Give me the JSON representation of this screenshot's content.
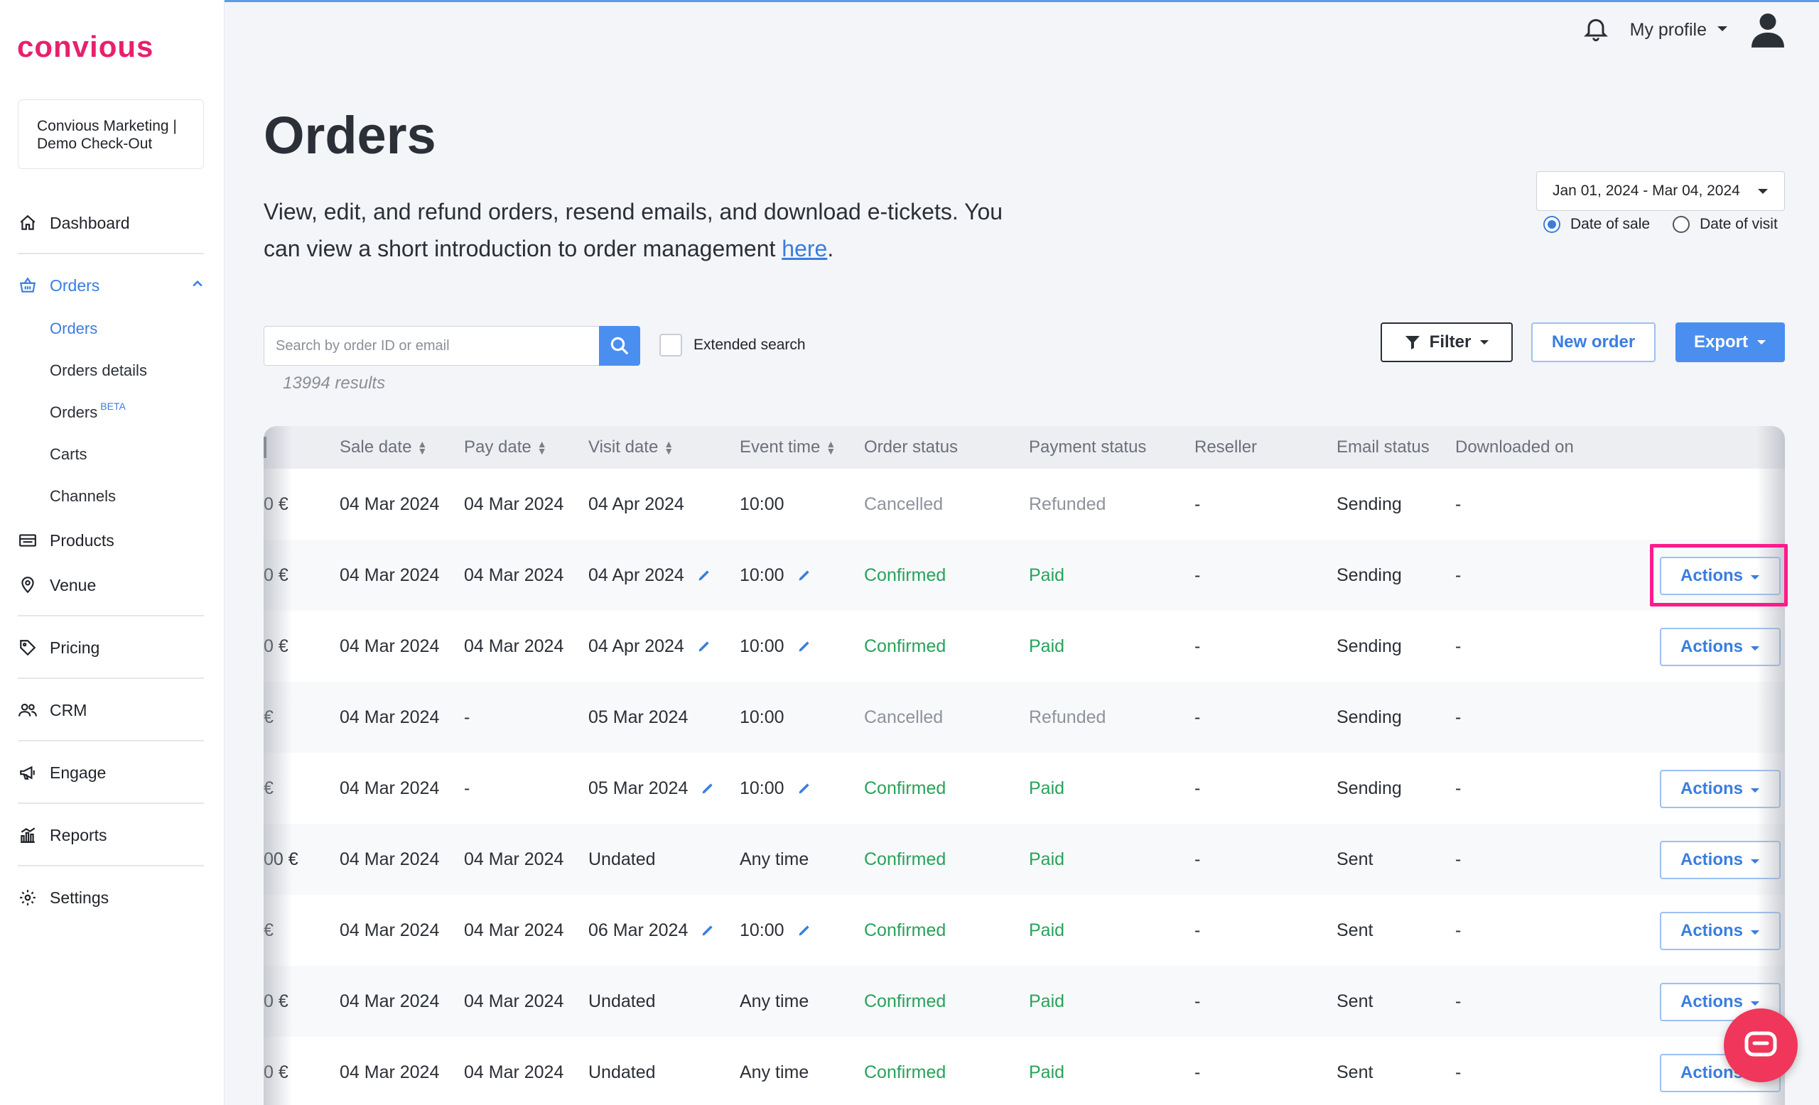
{
  "brand": {
    "logo_text": "convious",
    "logo_color": "#e8206e",
    "accent": "#3a7de0"
  },
  "sidebar": {
    "account": "Convious Marketing | Demo Check-Out",
    "nav": {
      "dashboard": "Dashboard",
      "orders": "Orders",
      "orders_sub": [
        "Orders",
        "Orders details",
        "Orders",
        "Carts",
        "Channels"
      ],
      "beta": "BETA",
      "products": "Products",
      "venue": "Venue",
      "pricing": "Pricing",
      "crm": "CRM",
      "engage": "Engage",
      "reports": "Reports",
      "settings": "Settings"
    }
  },
  "header": {
    "profile_label": "My profile"
  },
  "page": {
    "title": "Orders",
    "description": "View, edit, and refund orders, resend emails, and download e-tickets. You can view a short introduction to order management ",
    "link_text": "here",
    "period": "."
  },
  "date_filter": {
    "range": "Jan 01, 2024 - Mar 04, 2024",
    "options": [
      "Date of sale",
      "Date of visit"
    ],
    "selected": "Date of sale"
  },
  "toolbar": {
    "search_placeholder": "Search by order ID or email",
    "extended_search": "Extended search",
    "results": "13994 results",
    "filter": "Filter",
    "new_order": "New order",
    "export": "Export"
  },
  "table": {
    "columns": [
      "Sale date",
      "Pay date",
      "Visit date",
      "Event time",
      "Order status",
      "Payment status",
      "Reseller",
      "Email status",
      "Downloaded on"
    ],
    "actions_label": "Actions",
    "rows": [
      {
        "amount": "0 €",
        "sale": "04 Mar 2024",
        "pay": "04 Mar 2024",
        "visit": "04 Apr 2024",
        "time": "10:00",
        "order": "Cancelled",
        "payment": "Refunded",
        "reseller": "-",
        "email": "Sending",
        "downloaded": "-"
      },
      {
        "amount": "0 €",
        "sale": "04 Mar 2024",
        "pay": "04 Mar 2024",
        "visit": "04 Apr 2024",
        "time": "10:00",
        "order": "Confirmed",
        "payment": "Paid",
        "reseller": "-",
        "email": "Sending",
        "downloaded": "-"
      },
      {
        "amount": "0 €",
        "sale": "04 Mar 2024",
        "pay": "04 Mar 2024",
        "visit": "04 Apr 2024",
        "time": "10:00",
        "order": "Confirmed",
        "payment": "Paid",
        "reseller": "-",
        "email": "Sending",
        "downloaded": "-"
      },
      {
        "amount": "€",
        "sale": "04 Mar 2024",
        "pay": "-",
        "visit": "05 Mar 2024",
        "time": "10:00",
        "order": "Cancelled",
        "payment": "Refunded",
        "reseller": "-",
        "email": "Sending",
        "downloaded": "-"
      },
      {
        "amount": "€",
        "sale": "04 Mar 2024",
        "pay": "-",
        "visit": "05 Mar 2024",
        "time": "10:00",
        "order": "Confirmed",
        "payment": "Paid",
        "reseller": "-",
        "email": "Sending",
        "downloaded": "-"
      },
      {
        "amount": "00 €",
        "sale": "04 Mar 2024",
        "pay": "04 Mar 2024",
        "visit": "Undated",
        "time": "Any time",
        "order": "Confirmed",
        "payment": "Paid",
        "reseller": "-",
        "email": "Sent",
        "downloaded": "-"
      },
      {
        "amount": "€",
        "sale": "04 Mar 2024",
        "pay": "04 Mar 2024",
        "visit": "06 Mar 2024",
        "time": "10:00",
        "order": "Confirmed",
        "payment": "Paid",
        "reseller": "-",
        "email": "Sent",
        "downloaded": "-"
      },
      {
        "amount": "0 €",
        "sale": "04 Mar 2024",
        "pay": "04 Mar 2024",
        "visit": "Undated",
        "time": "Any time",
        "order": "Confirmed",
        "payment": "Paid",
        "reseller": "-",
        "email": "Sent",
        "downloaded": "-"
      },
      {
        "amount": "0 €",
        "sale": "04 Mar 2024",
        "pay": "04 Mar 2024",
        "visit": "Undated",
        "time": "Any time",
        "order": "Confirmed",
        "payment": "Paid",
        "reseller": "-",
        "email": "Sent",
        "downloaded": "-"
      }
    ]
  }
}
